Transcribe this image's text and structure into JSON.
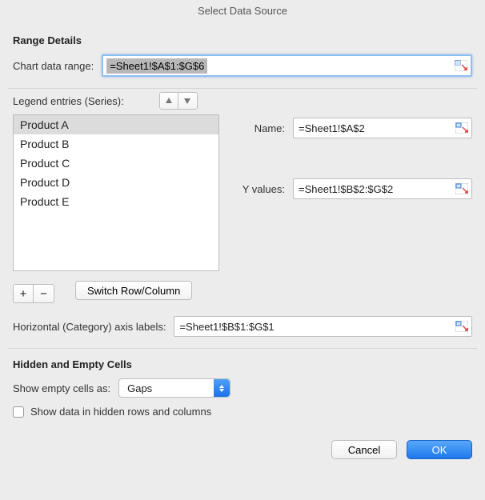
{
  "title": "Select Data Source",
  "range_details": {
    "heading": "Range Details",
    "label": "Chart data range:",
    "value": "=Sheet1!$A$1:$G$6"
  },
  "series": {
    "heading": "Legend entries (Series):",
    "items": [
      "Product A",
      "Product B",
      "Product C",
      "Product D",
      "Product E"
    ],
    "selected_index": 0,
    "name_label": "Name:",
    "name_value": "=Sheet1!$A$2",
    "yvalues_label": "Y values:",
    "yvalues_value": "=Sheet1!$B$2:$G$2",
    "add_label": "+",
    "remove_label": "−",
    "switch_label": "Switch Row/Column"
  },
  "haxis": {
    "label": "Horizontal (Category) axis labels:",
    "value": "=Sheet1!$B$1:$G$1"
  },
  "hidden_empty": {
    "heading": "Hidden and Empty Cells",
    "show_empty_label": "Show empty cells as:",
    "show_empty_value": "Gaps",
    "show_hidden_label": "Show data in hidden rows and columns",
    "show_hidden_checked": false
  },
  "footer": {
    "cancel": "Cancel",
    "ok": "OK"
  }
}
